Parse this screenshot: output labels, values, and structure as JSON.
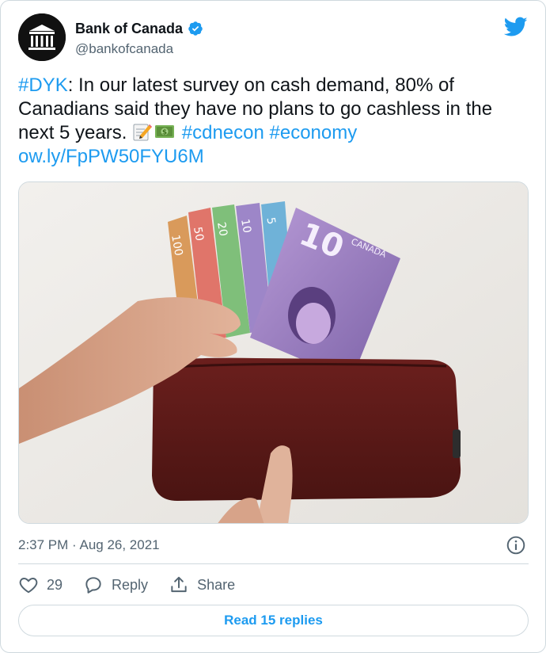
{
  "author": {
    "name": "Bank of Canada",
    "handle": "@bankofcanada"
  },
  "tweet": {
    "hashtag_dyk": "#DYK",
    "text_body": ": In our latest survey on cash demand, 80% of Canadians said they have no plans to go cashless in the next 5 years. ",
    "emojis": [
      "memo-emoji",
      "dollar-banknote-emoji"
    ],
    "hashtag_cdnecon": "#cdnecon",
    "hashtag_economy": "#economy",
    "link": "ow.ly/FpPW50FYU6M"
  },
  "media": {
    "banknote_front_value": "10",
    "banknote_country": "CANADA",
    "banknote_back_values": [
      "100",
      "50",
      "20",
      "10",
      "5"
    ]
  },
  "timestamp": "2:37 PM · Aug 26, 2021",
  "actions": {
    "like_count": "29",
    "reply_label": "Reply",
    "share_label": "Share"
  },
  "read_replies_label": "Read 15 replies",
  "colors": {
    "accent": "#1d9bf0",
    "muted": "#536471",
    "border": "#cfd9de"
  }
}
